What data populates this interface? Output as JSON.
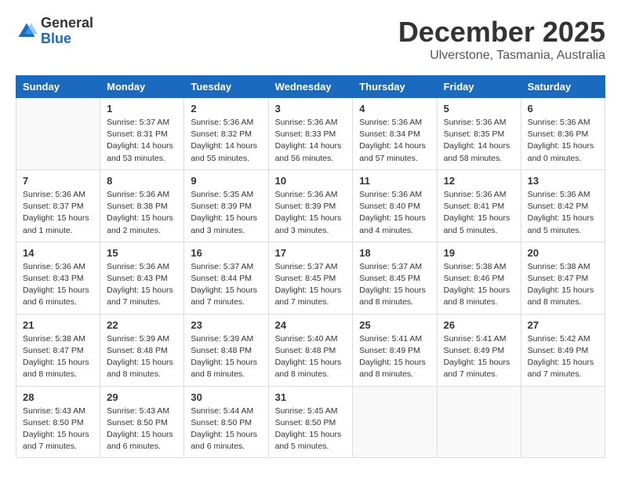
{
  "header": {
    "logo_general": "General",
    "logo_blue": "Blue",
    "month_title": "December 2025",
    "subtitle": "Ulverstone, Tasmania, Australia"
  },
  "days_of_week": [
    "Sunday",
    "Monday",
    "Tuesday",
    "Wednesday",
    "Thursday",
    "Friday",
    "Saturday"
  ],
  "weeks": [
    [
      {
        "day": "",
        "info": ""
      },
      {
        "day": "1",
        "info": "Sunrise: 5:37 AM\nSunset: 8:31 PM\nDaylight: 14 hours\nand 53 minutes."
      },
      {
        "day": "2",
        "info": "Sunrise: 5:36 AM\nSunset: 8:32 PM\nDaylight: 14 hours\nand 55 minutes."
      },
      {
        "day": "3",
        "info": "Sunrise: 5:36 AM\nSunset: 8:33 PM\nDaylight: 14 hours\nand 56 minutes."
      },
      {
        "day": "4",
        "info": "Sunrise: 5:36 AM\nSunset: 8:34 PM\nDaylight: 14 hours\nand 57 minutes."
      },
      {
        "day": "5",
        "info": "Sunrise: 5:36 AM\nSunset: 8:35 PM\nDaylight: 14 hours\nand 58 minutes."
      },
      {
        "day": "6",
        "info": "Sunrise: 5:36 AM\nSunset: 8:36 PM\nDaylight: 15 hours\nand 0 minutes."
      }
    ],
    [
      {
        "day": "7",
        "info": "Sunrise: 5:36 AM\nSunset: 8:37 PM\nDaylight: 15 hours\nand 1 minute."
      },
      {
        "day": "8",
        "info": "Sunrise: 5:36 AM\nSunset: 8:38 PM\nDaylight: 15 hours\nand 2 minutes."
      },
      {
        "day": "9",
        "info": "Sunrise: 5:35 AM\nSunset: 8:39 PM\nDaylight: 15 hours\nand 3 minutes."
      },
      {
        "day": "10",
        "info": "Sunrise: 5:36 AM\nSunset: 8:39 PM\nDaylight: 15 hours\nand 3 minutes."
      },
      {
        "day": "11",
        "info": "Sunrise: 5:36 AM\nSunset: 8:40 PM\nDaylight: 15 hours\nand 4 minutes."
      },
      {
        "day": "12",
        "info": "Sunrise: 5:36 AM\nSunset: 8:41 PM\nDaylight: 15 hours\nand 5 minutes."
      },
      {
        "day": "13",
        "info": "Sunrise: 5:36 AM\nSunset: 8:42 PM\nDaylight: 15 hours\nand 5 minutes."
      }
    ],
    [
      {
        "day": "14",
        "info": "Sunrise: 5:36 AM\nSunset: 8:43 PM\nDaylight: 15 hours\nand 6 minutes."
      },
      {
        "day": "15",
        "info": "Sunrise: 5:36 AM\nSunset: 8:43 PM\nDaylight: 15 hours\nand 7 minutes."
      },
      {
        "day": "16",
        "info": "Sunrise: 5:37 AM\nSunset: 8:44 PM\nDaylight: 15 hours\nand 7 minutes."
      },
      {
        "day": "17",
        "info": "Sunrise: 5:37 AM\nSunset: 8:45 PM\nDaylight: 15 hours\nand 7 minutes."
      },
      {
        "day": "18",
        "info": "Sunrise: 5:37 AM\nSunset: 8:45 PM\nDaylight: 15 hours\nand 8 minutes."
      },
      {
        "day": "19",
        "info": "Sunrise: 5:38 AM\nSunset: 8:46 PM\nDaylight: 15 hours\nand 8 minutes."
      },
      {
        "day": "20",
        "info": "Sunrise: 5:38 AM\nSunset: 8:47 PM\nDaylight: 15 hours\nand 8 minutes."
      }
    ],
    [
      {
        "day": "21",
        "info": "Sunrise: 5:38 AM\nSunset: 8:47 PM\nDaylight: 15 hours\nand 8 minutes."
      },
      {
        "day": "22",
        "info": "Sunrise: 5:39 AM\nSunset: 8:48 PM\nDaylight: 15 hours\nand 8 minutes."
      },
      {
        "day": "23",
        "info": "Sunrise: 5:39 AM\nSunset: 8:48 PM\nDaylight: 15 hours\nand 8 minutes."
      },
      {
        "day": "24",
        "info": "Sunrise: 5:40 AM\nSunset: 8:48 PM\nDaylight: 15 hours\nand 8 minutes."
      },
      {
        "day": "25",
        "info": "Sunrise: 5:41 AM\nSunset: 8:49 PM\nDaylight: 15 hours\nand 8 minutes."
      },
      {
        "day": "26",
        "info": "Sunrise: 5:41 AM\nSunset: 8:49 PM\nDaylight: 15 hours\nand 7 minutes."
      },
      {
        "day": "27",
        "info": "Sunrise: 5:42 AM\nSunset: 8:49 PM\nDaylight: 15 hours\nand 7 minutes."
      }
    ],
    [
      {
        "day": "28",
        "info": "Sunrise: 5:43 AM\nSunset: 8:50 PM\nDaylight: 15 hours\nand 7 minutes."
      },
      {
        "day": "29",
        "info": "Sunrise: 5:43 AM\nSunset: 8:50 PM\nDaylight: 15 hours\nand 6 minutes."
      },
      {
        "day": "30",
        "info": "Sunrise: 5:44 AM\nSunset: 8:50 PM\nDaylight: 15 hours\nand 6 minutes."
      },
      {
        "day": "31",
        "info": "Sunrise: 5:45 AM\nSunset: 8:50 PM\nDaylight: 15 hours\nand 5 minutes."
      },
      {
        "day": "",
        "info": ""
      },
      {
        "day": "",
        "info": ""
      },
      {
        "day": "",
        "info": ""
      }
    ]
  ]
}
